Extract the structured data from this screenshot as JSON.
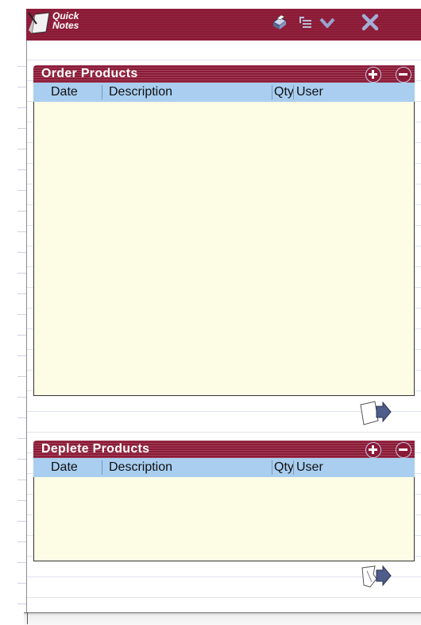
{
  "app": {
    "title_line1": "Quick",
    "title_line2": "Notes",
    "toolbar": [
      {
        "name": "print-icon"
      },
      {
        "name": "indent-list-icon"
      },
      {
        "name": "checkmark-icon"
      },
      {
        "name": "close-icon"
      }
    ],
    "colors": {
      "brand": "#8b1a36",
      "header_row": "#a9cef0",
      "list_bg": "#fdfde6",
      "icon_blue": "#4a5a8a"
    }
  },
  "order_panel": {
    "title": "Order Products",
    "columns": [
      "Date",
      "Description",
      "Qty",
      "User"
    ],
    "rows": [],
    "action_icon": "export-note-icon"
  },
  "deplete_panel": {
    "title": "Deplete Products",
    "columns": [
      "Date",
      "Description",
      "Qty",
      "User"
    ],
    "rows": [],
    "action_icon": "export-broken-note-icon"
  }
}
